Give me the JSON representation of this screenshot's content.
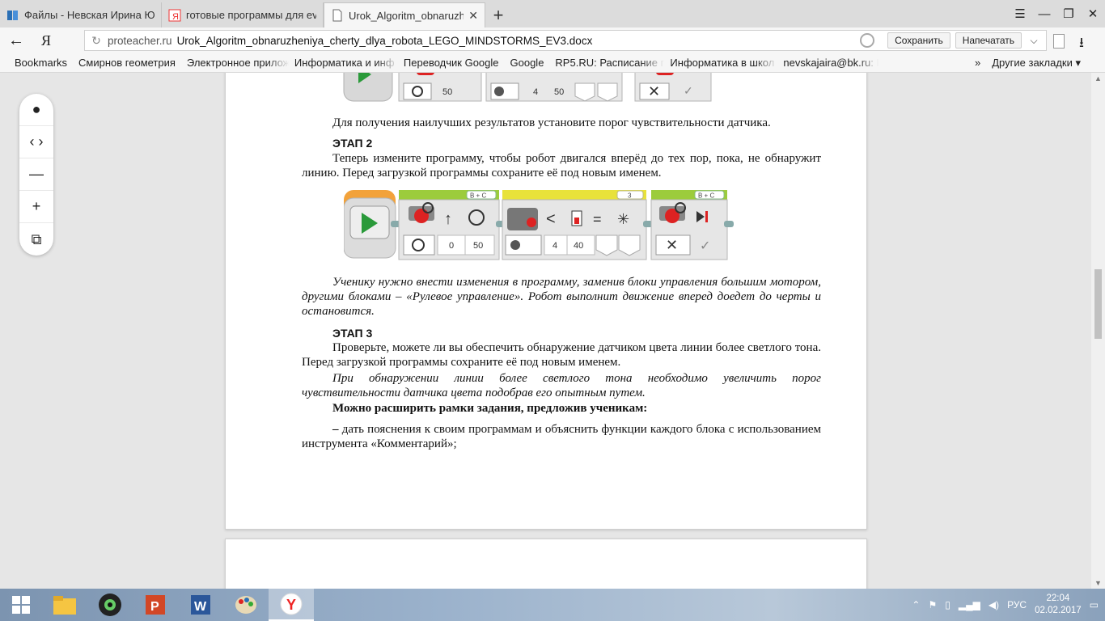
{
  "tabs": [
    {
      "title": "Файлы - Невская Ирина Юр"
    },
    {
      "title": "готовые программы для ev"
    },
    {
      "title": "Urok_Algoritm_obnaruzhe"
    }
  ],
  "address": {
    "domain": "proteacher.ru",
    "path": "Urok_Algoritm_obnaruzheniya_cherty_dlya_robota_LEGO_MINDSTORMS_EV3.docx",
    "save_label": "Сохранить",
    "print_label": "Напечатать"
  },
  "bookmarks": {
    "items": [
      "Bookmarks",
      "Смирнов геометрия",
      "Электронное прилож",
      "Информатика и инф",
      "Переводчик Google",
      "Google",
      "RP5.RU: Расписание г",
      "Информатика в школ",
      "nevskajaira@bk.ru: Вх"
    ],
    "more": "»",
    "other": "Другие закладки"
  },
  "document": {
    "caption1": "Для получения наилучших результатов установите порог чувствительности датчика.",
    "stage2_title": "ЭТАП 2",
    "stage2_text": "Теперь измените программу, чтобы робот двигался вперёд до тех пор, пока, не обнаружит линию. Перед загрузкой программы сохраните её под новым именем.",
    "stage2_note": "Ученику нужно внести изменения в программу, заменив блоки управления большим мотором, другими блоками – «Рулевое управление». Робот выполнит движение вперед доедет до черты и остановится.",
    "stage3_title": "ЭТАП 3",
    "stage3_text": "Проверьте, можете ли вы обеспечить обнаружение датчиком цвета линии более светлого тона. Перед загрузкой программы сохраните её под новым именем.",
    "stage3_note": "При обнаружении линии более светлого тона необходимо увеличить порог чувствительности датчика цвета подобрав его опытным путем.",
    "extend_title": "Можно расширить рамки задания, предложив ученикам:",
    "extend_item": "дать пояснения к своим программам и объяснить функции каждого блока с использованием инструмента «Комментарий»;",
    "dash": "–"
  },
  "program_top": {
    "values": [
      "50",
      "4",
      "50"
    ]
  },
  "program_main": {
    "port_label_1": "B + C",
    "port_label_2": "3",
    "port_label_3": "B + C",
    "steer_values": [
      "0",
      "50"
    ],
    "sensor_values": [
      "4",
      "40"
    ],
    "compare_symbol": "<",
    "equals_symbol": "="
  },
  "taskbar": {
    "lang": "РУС",
    "time": "22:04",
    "date": "02.02.2017"
  },
  "colors": {
    "block_green": "#9ccc3c",
    "block_yellow": "#e8e23a",
    "block_orange": "#f2a23a"
  }
}
